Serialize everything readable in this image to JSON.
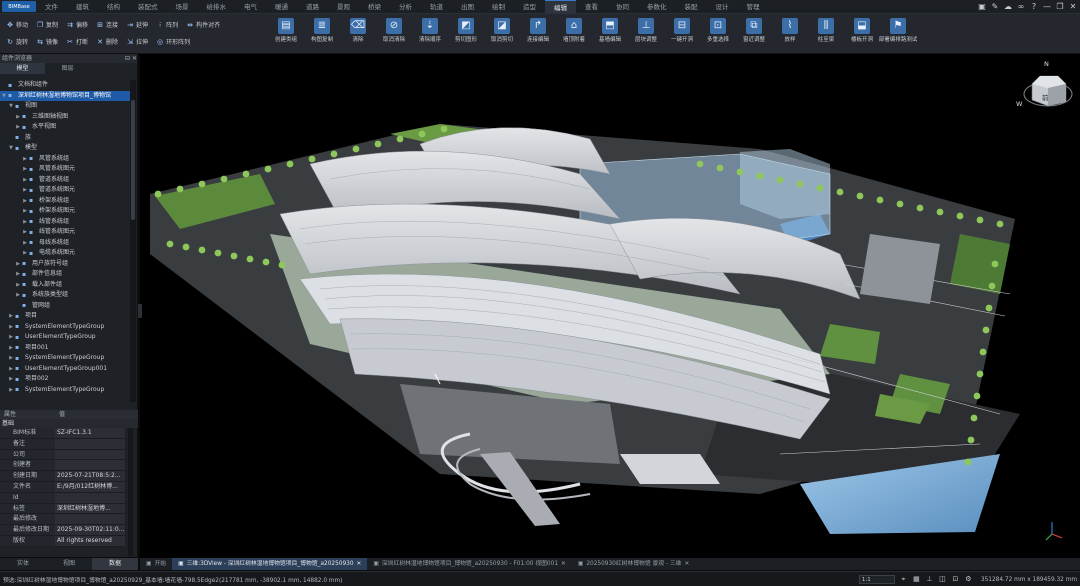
{
  "app": {
    "logo": "BIMBase"
  },
  "menu_tabs": [
    "文件",
    "建筑",
    "结构",
    "装配式",
    "场景",
    "给排水",
    "电气",
    "暖通",
    "道路",
    "景观",
    "桥梁",
    "分析",
    "轨道",
    "出图",
    "绘制",
    "造型",
    "编辑",
    "查看",
    "协同",
    "参数化",
    "装配",
    "设计",
    "管理"
  ],
  "menu_active": "编辑",
  "window_controls": [
    "square-icon",
    "pen-icon",
    "cloud-icon",
    "link-icon",
    "help-icon",
    "minimize-icon",
    "restore-icon",
    "close-icon"
  ],
  "ribbon": {
    "row1": [
      {
        "icon": "move-icon",
        "glyph": "✥",
        "label": "移动"
      },
      {
        "icon": "copy-icon",
        "glyph": "❐",
        "label": "复制"
      },
      {
        "icon": "offset-icon",
        "glyph": "⇉",
        "label": "偏移"
      },
      {
        "icon": "join-icon",
        "glyph": "⊞",
        "label": "连接"
      },
      {
        "icon": "extend-icon",
        "glyph": "⇥",
        "label": "延伸"
      },
      {
        "icon": "array-icon",
        "glyph": "⁝",
        "label": "阵列"
      },
      {
        "icon": "align-icon",
        "glyph": "⇹",
        "label": "构件对齐"
      }
    ],
    "row2": [
      {
        "icon": "rotate-icon",
        "glyph": "↻",
        "label": "旋转"
      },
      {
        "icon": "mirror-icon",
        "glyph": "⇆",
        "label": "镜像"
      },
      {
        "icon": "break-icon",
        "glyph": "✂",
        "label": "打断"
      },
      {
        "icon": "delete-icon",
        "glyph": "✕",
        "label": "删除"
      },
      {
        "icon": "stretch-icon",
        "glyph": "⇲",
        "label": "拉伸"
      },
      {
        "icon": "ring-array-icon",
        "glyph": "◎",
        "label": "环形阵列"
      }
    ],
    "big": [
      {
        "icon": "create-wall-icon",
        "glyph": "▤",
        "label": "创建类组"
      },
      {
        "icon": "stack-icon",
        "glyph": "≣",
        "label": "构图复制"
      },
      {
        "icon": "clear-icon",
        "glyph": "⌫",
        "label": "清除"
      },
      {
        "icon": "cancel-clear-icon",
        "glyph": "⊘",
        "label": "取消清除"
      },
      {
        "icon": "clear-order-icon",
        "glyph": "⇣",
        "label": "清除顺序"
      },
      {
        "icon": "cut-icon",
        "glyph": "◩",
        "label": "剪切图形"
      },
      {
        "icon": "cancel-cut-icon",
        "glyph": "◪",
        "label": "取消剪切"
      },
      {
        "icon": "edit-connect-icon",
        "glyph": "↱",
        "label": "连接编辑"
      },
      {
        "icon": "wall-attach-icon",
        "glyph": "⌂",
        "label": "墙顶附着"
      },
      {
        "icon": "base-edit-icon",
        "glyph": "⬒",
        "label": "基墙编辑"
      },
      {
        "icon": "layer-adjust-icon",
        "glyph": "⊥",
        "label": "层块调整"
      },
      {
        "icon": "open-hole-icon",
        "glyph": "⊟",
        "label": "一键开洞"
      },
      {
        "icon": "multi-select-icon",
        "glyph": "⊡",
        "label": "多重选择"
      },
      {
        "icon": "window-adjust-icon",
        "glyph": "⧉",
        "label": "窗近调整"
      },
      {
        "icon": "stair-icon",
        "glyph": "⌇",
        "label": "放样"
      },
      {
        "icon": "column-icon",
        "glyph": "⫼",
        "label": "柱至梁"
      },
      {
        "icon": "mark-floor-icon",
        "glyph": "⬓",
        "label": "楼板开洞"
      },
      {
        "icon": "deploy-icon",
        "glyph": "⚑",
        "label": "部署编排路测试"
      }
    ]
  },
  "left_panel": {
    "title": "组件浏览器",
    "tabs": [
      "模型",
      "图层"
    ],
    "tree": [
      {
        "level": 0,
        "tw": "",
        "label": "文档和组件"
      },
      {
        "level": 0,
        "tw": "▼",
        "label": "深圳红树林湿地博物馆项目_博物馆",
        "selected": true
      },
      {
        "level": 1,
        "tw": "▼",
        "label": "视图"
      },
      {
        "level": 2,
        "tw": "▶",
        "label": "三维图轴视图"
      },
      {
        "level": 2,
        "tw": "▶",
        "label": "水平视图"
      },
      {
        "level": 1,
        "tw": "",
        "label": "族"
      },
      {
        "level": 1,
        "tw": "▼",
        "label": "模型"
      },
      {
        "level": 3,
        "tw": "▶",
        "label": "风管系统组"
      },
      {
        "level": 3,
        "tw": "▶",
        "label": "风管系统图元"
      },
      {
        "level": 3,
        "tw": "▶",
        "label": "管道系统组"
      },
      {
        "level": 3,
        "tw": "▶",
        "label": "管道系统图元"
      },
      {
        "level": 3,
        "tw": "▶",
        "label": "桥架系统组"
      },
      {
        "level": 3,
        "tw": "▶",
        "label": "桥架系统图元"
      },
      {
        "level": 3,
        "tw": "▶",
        "label": "线管系统组"
      },
      {
        "level": 3,
        "tw": "▶",
        "label": "线管系统图元"
      },
      {
        "level": 3,
        "tw": "▶",
        "label": "母线系统组"
      },
      {
        "level": 3,
        "tw": "▶",
        "label": "电缆系统图元"
      },
      {
        "level": 2,
        "tw": "▶",
        "label": "用户族符号组"
      },
      {
        "level": 2,
        "tw": "▶",
        "label": "部件信息组"
      },
      {
        "level": 2,
        "tw": "▶",
        "label": "载入部件组"
      },
      {
        "level": 2,
        "tw": "▶",
        "label": "系统族类型组"
      },
      {
        "level": 2,
        "tw": "",
        "label": "管网组"
      },
      {
        "level": 1,
        "tw": "▶",
        "label": "项目"
      },
      {
        "level": 1,
        "tw": "▶",
        "label": "SystemElementTypeGroup"
      },
      {
        "level": 1,
        "tw": "▶",
        "label": "UserElementTypeGroup"
      },
      {
        "level": 1,
        "tw": "▶",
        "label": "项目001"
      },
      {
        "level": 1,
        "tw": "▶",
        "label": "SystemElementTypeGroup"
      },
      {
        "level": 1,
        "tw": "▶",
        "label": "UserElementTypeGroup001"
      },
      {
        "level": 1,
        "tw": "▶",
        "label": "项目002"
      },
      {
        "level": 1,
        "tw": "▶",
        "label": "SystemElementTypeGroup"
      }
    ],
    "props_head": [
      "属性",
      "值"
    ],
    "props_group": "基础",
    "props": [
      {
        "k": "BIM标准",
        "v": "SZ-IFC1.3.1"
      },
      {
        "k": "备注",
        "v": ""
      },
      {
        "k": "公司",
        "v": ""
      },
      {
        "k": "创建者",
        "v": ""
      },
      {
        "k": "创建日期",
        "v": "2025-07-21T08:5:2..."
      },
      {
        "k": "文件名",
        "v": "E:/9月/012红树林博..."
      },
      {
        "k": "Id",
        "v": ""
      },
      {
        "k": "标签",
        "v": "深圳红树林湿地博..."
      },
      {
        "k": "最后修改",
        "v": ""
      },
      {
        "k": "最后修改日期",
        "v": "2025-09-30T02:11:0..."
      },
      {
        "k": "版权",
        "v": "All rights reserved"
      }
    ]
  },
  "bottom_tabs": [
    "实体",
    "视图",
    "数据"
  ],
  "bottom_tab_active": 2,
  "view_cube": {
    "n": "N",
    "w": "W",
    "e": "",
    "face": "前"
  },
  "doc_tabs": [
    {
      "label": "开始",
      "active": false
    },
    {
      "label": "三维:3DView - 深圳红树林湿地博物馆项目_博物馆_a20250930",
      "active": true
    },
    {
      "label": "深圳红树林湿地博物馆项目_博物馆_a20250930 - F01:00 视图001",
      "active": false
    },
    {
      "label": "20250930红树林博物馆 景观 - 三维",
      "active": false
    }
  ],
  "status": {
    "text": "预选:深圳红树林湿地博物馆项目_博物馆_a20250929_基本墙:墙花墙-798.5Edge2(217781 mm, -38902.1 mm, 14882.0 mm)",
    "scale": "1:1",
    "coords": "351284.72 mm x 189459.32 mm"
  },
  "colors": {
    "accent": "#1f5aa6",
    "viewport": "#000000",
    "panel": "#1e2126"
  }
}
